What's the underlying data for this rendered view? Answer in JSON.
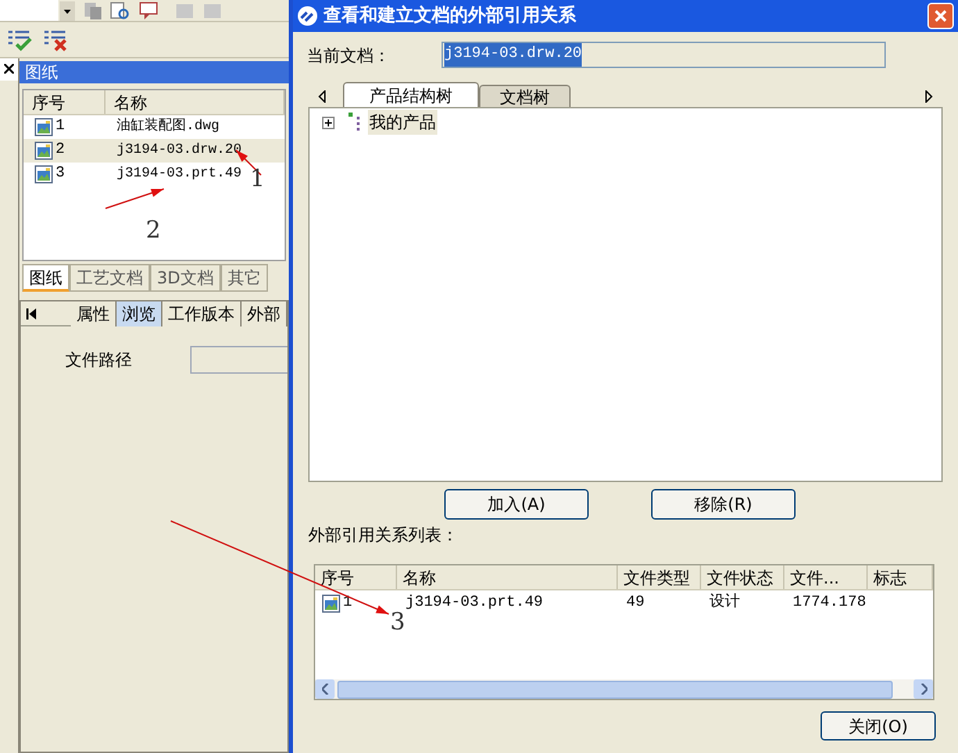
{
  "left_panel": {
    "title": "图纸",
    "list": {
      "columns": [
        "序号",
        "名称"
      ],
      "rows": [
        {
          "index": "1",
          "name": "油缸装配图.dwg",
          "selected": false
        },
        {
          "index": "2",
          "name": "j3194-03.drw.20",
          "selected": true
        },
        {
          "index": "3",
          "name": "j3194-03.prt.49",
          "selected": false
        }
      ]
    },
    "tabs": [
      {
        "label": "图纸",
        "selected": true
      },
      {
        "label": "工艺文档",
        "selected": false
      },
      {
        "label": "3D文档",
        "selected": false
      },
      {
        "label": "其它",
        "selected": false
      }
    ],
    "lower_tabs": [
      {
        "label": "属性",
        "selected": false
      },
      {
        "label": "浏览",
        "selected": true
      },
      {
        "label": "工作版本",
        "selected": false
      },
      {
        "label": "外部",
        "selected": false
      }
    ],
    "path_label": "文件路径"
  },
  "dialog": {
    "title": "查看和建立文档的外部引用关系",
    "current_doc_label": "当前文档：",
    "current_doc": "j3194-03.drw.20",
    "tabs": [
      {
        "label": "产品结构树",
        "selected": true
      },
      {
        "label": "文档树",
        "selected": false
      }
    ],
    "tree": [
      {
        "label": "我的产品",
        "expanded": false
      }
    ],
    "buttons": [
      "加入(A)",
      "移除(R)"
    ],
    "list_label": "外部引用关系列表：",
    "table": {
      "columns": [
        "序号",
        "名称",
        "文件类型",
        "文件状态",
        "文件...",
        "标志"
      ],
      "rows": [
        {
          "cells": [
            "1",
            "j3194-03.prt.49",
            "49",
            "设计",
            "1774.178",
            ""
          ]
        }
      ]
    },
    "close_button": "关闭(O)"
  },
  "annotations": [
    "1",
    "2",
    "3"
  ]
}
